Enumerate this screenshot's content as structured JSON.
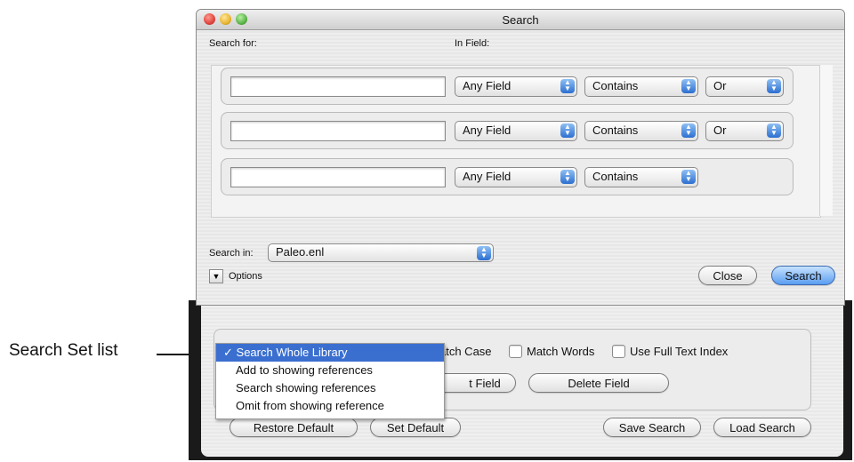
{
  "callout": {
    "label": "Search Set list"
  },
  "window": {
    "title": "Search",
    "search_for_label": "Search for:",
    "in_field_label": "In Field:",
    "rows": [
      {
        "field": "Any Field",
        "condition": "Contains",
        "bool": "Or"
      },
      {
        "field": "Any Field",
        "condition": "Contains",
        "bool": "Or"
      },
      {
        "field": "Any Field",
        "condition": "Contains",
        "bool": ""
      }
    ],
    "search_in_label": "Search in:",
    "search_in_value": "Paleo.enl",
    "options_label": "Options",
    "close_label": "Close",
    "search_label": "Search"
  },
  "back": {
    "match_case": "atch Case",
    "match_words": "Match Words",
    "full_text": "Use Full Text Index",
    "insert_field": "t Field",
    "delete_field": "Delete Field",
    "restore_default": "Restore Default",
    "set_default": "Set Default",
    "save_search": "Save Search",
    "load_search": "Load Search"
  },
  "menu": {
    "items": [
      {
        "label": "Search Whole Library",
        "checked": true
      },
      {
        "label": "Add to showing references",
        "checked": false
      },
      {
        "label": "Search showing references",
        "checked": false
      },
      {
        "label": "Omit from showing reference",
        "checked": false
      }
    ],
    "check_mark": "✓"
  },
  "colors": {
    "accent": "#3a6fd0",
    "close_red": "#e0443e",
    "minimize_yellow": "#e8b52f",
    "zoom_green": "#5bb449"
  }
}
